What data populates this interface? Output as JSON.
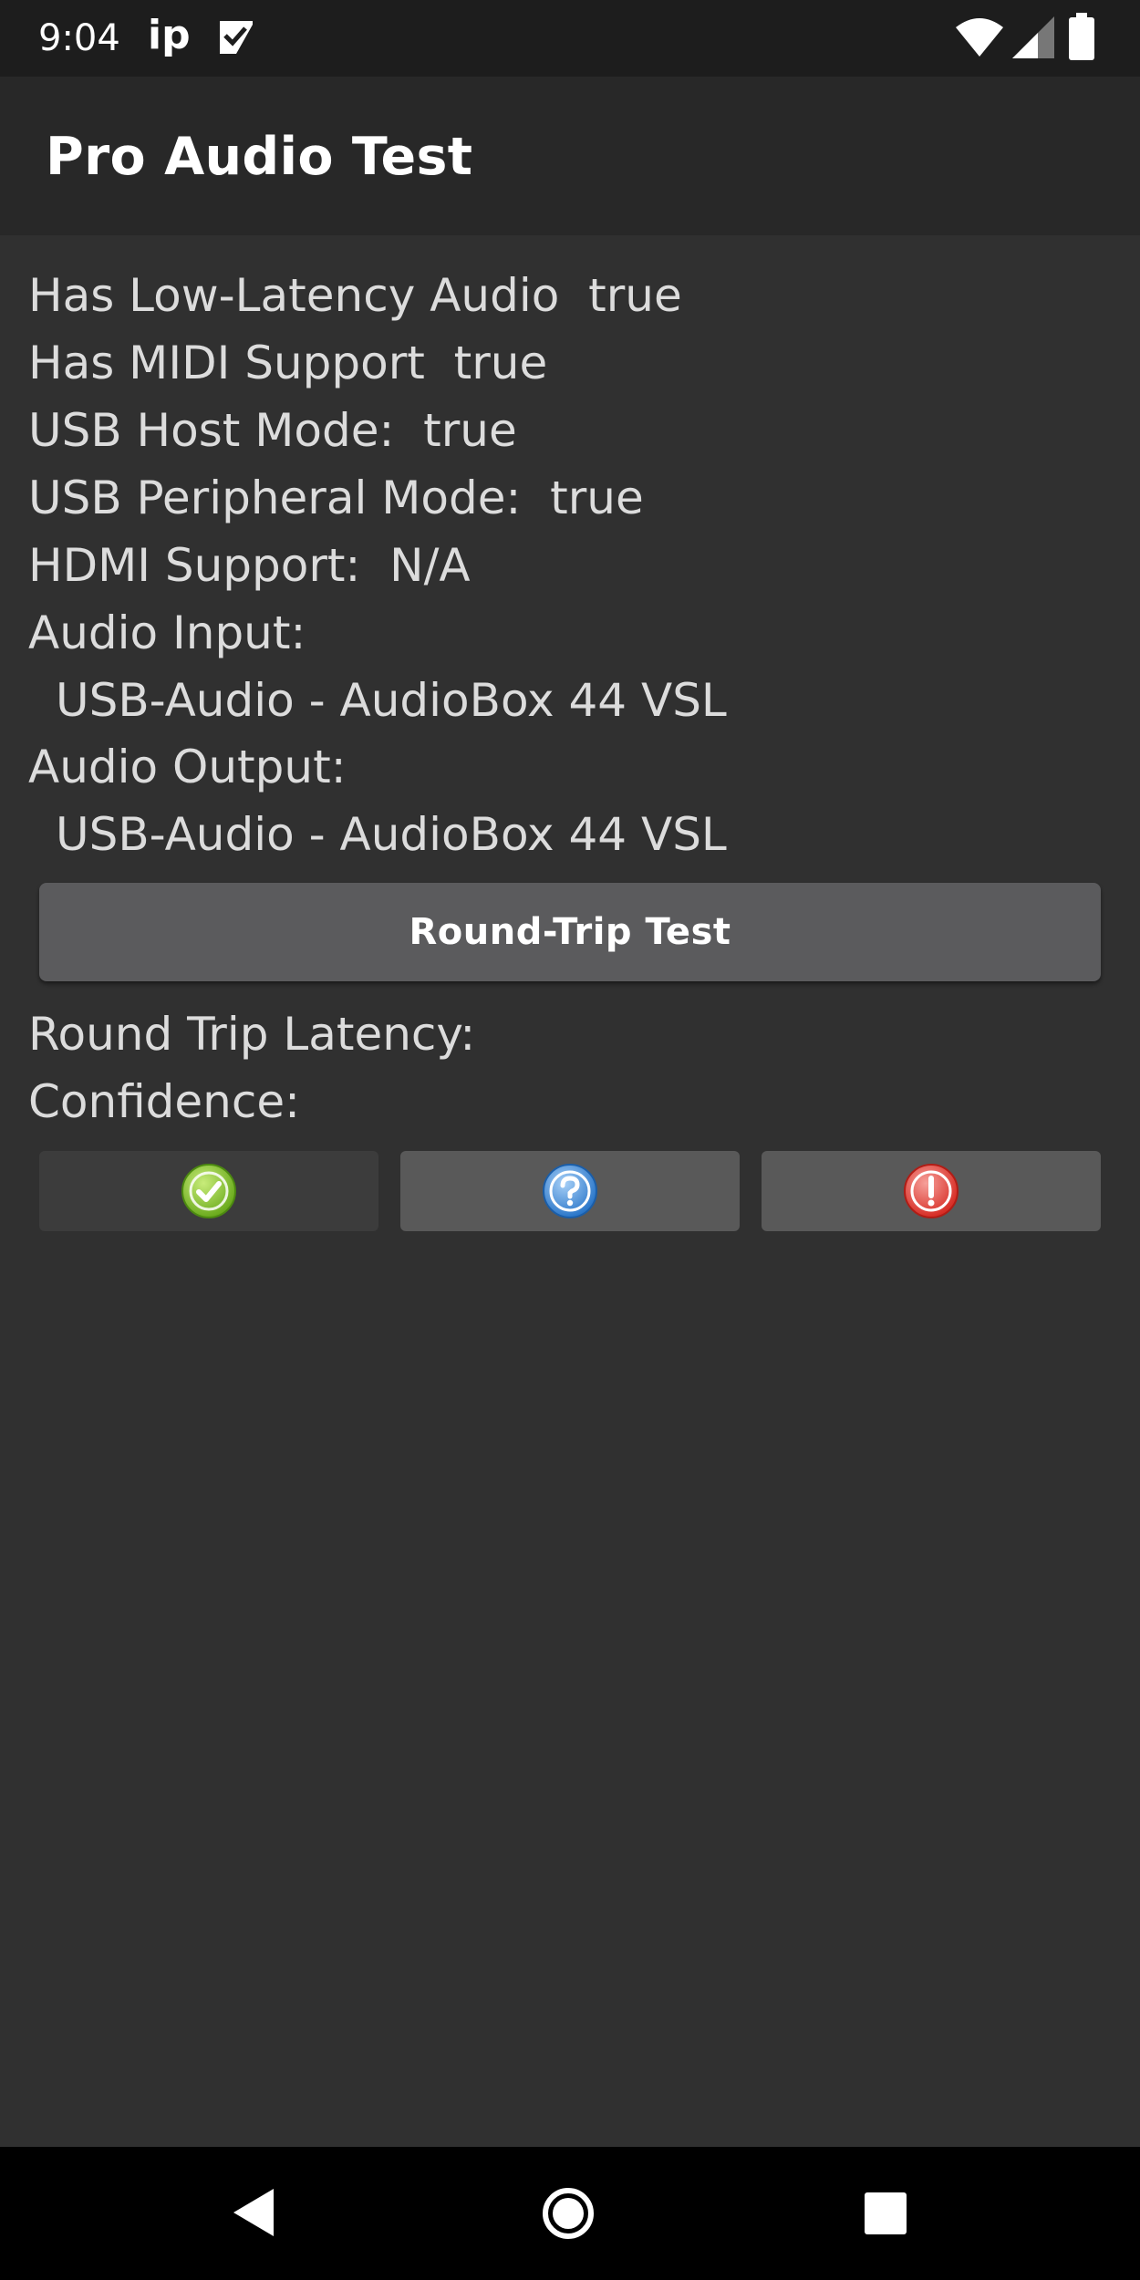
{
  "status_bar": {
    "time": "9:04",
    "carrier_label": "ip",
    "icons": [
      "checkmark-notification-icon",
      "wifi-icon",
      "signal-icon",
      "battery-icon"
    ]
  },
  "app_bar": {
    "title": "Pro Audio Test"
  },
  "info": {
    "low_latency": "Has Low-Latency Audio  true",
    "midi": "Has MIDI Support  true",
    "usb_host": "USB Host Mode:  true",
    "usb_peripheral": "USB Peripheral Mode:  true",
    "hdmi": "HDMI Support:  N/A",
    "audio_input_label": "Audio Input:",
    "audio_input_value": "USB-Audio - AudioBox 44 VSL",
    "audio_output_label": "Audio Output:",
    "audio_output_value": "USB-Audio - AudioBox 44 VSL"
  },
  "round_trip": {
    "button_label": "Round-Trip Test",
    "latency_label": "Round Trip Latency:",
    "confidence_label": "Confidence:"
  },
  "confidence_buttons": [
    {
      "icon": "check-circle-icon",
      "color": "#8cc63f"
    },
    {
      "icon": "question-circle-icon",
      "color": "#3b8de0"
    },
    {
      "icon": "exclamation-circle-icon",
      "color": "#e5413c"
    }
  ],
  "nav_bar": {
    "icons": [
      "back-icon",
      "home-icon",
      "recents-icon"
    ]
  }
}
